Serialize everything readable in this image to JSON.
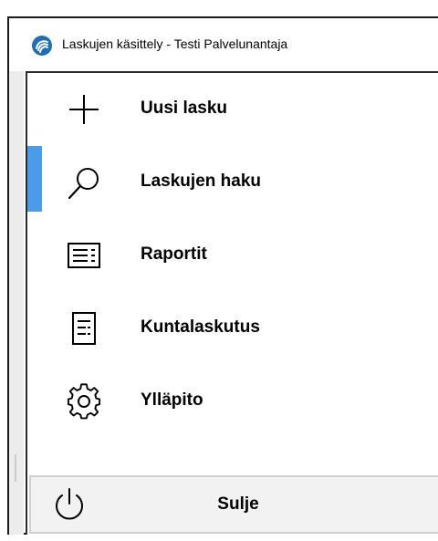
{
  "window": {
    "title": "Laskujen käsittely - Testi Palvelunantaja"
  },
  "menu": {
    "items": [
      {
        "label": "Uusi lasku",
        "icon": "plus-icon"
      },
      {
        "label": "Laskujen haku",
        "icon": "search-icon",
        "selected": true
      },
      {
        "label": "Raportit",
        "icon": "report-icon"
      },
      {
        "label": "Kuntalaskutus",
        "icon": "document-icon"
      },
      {
        "label": "Ylläpito",
        "icon": "gear-icon"
      }
    ],
    "close_label": "Sulje",
    "close_icon": "power-icon"
  },
  "colors": {
    "selection_accent": "#4c9be8",
    "close_bar_bg": "#f2f2f2"
  }
}
